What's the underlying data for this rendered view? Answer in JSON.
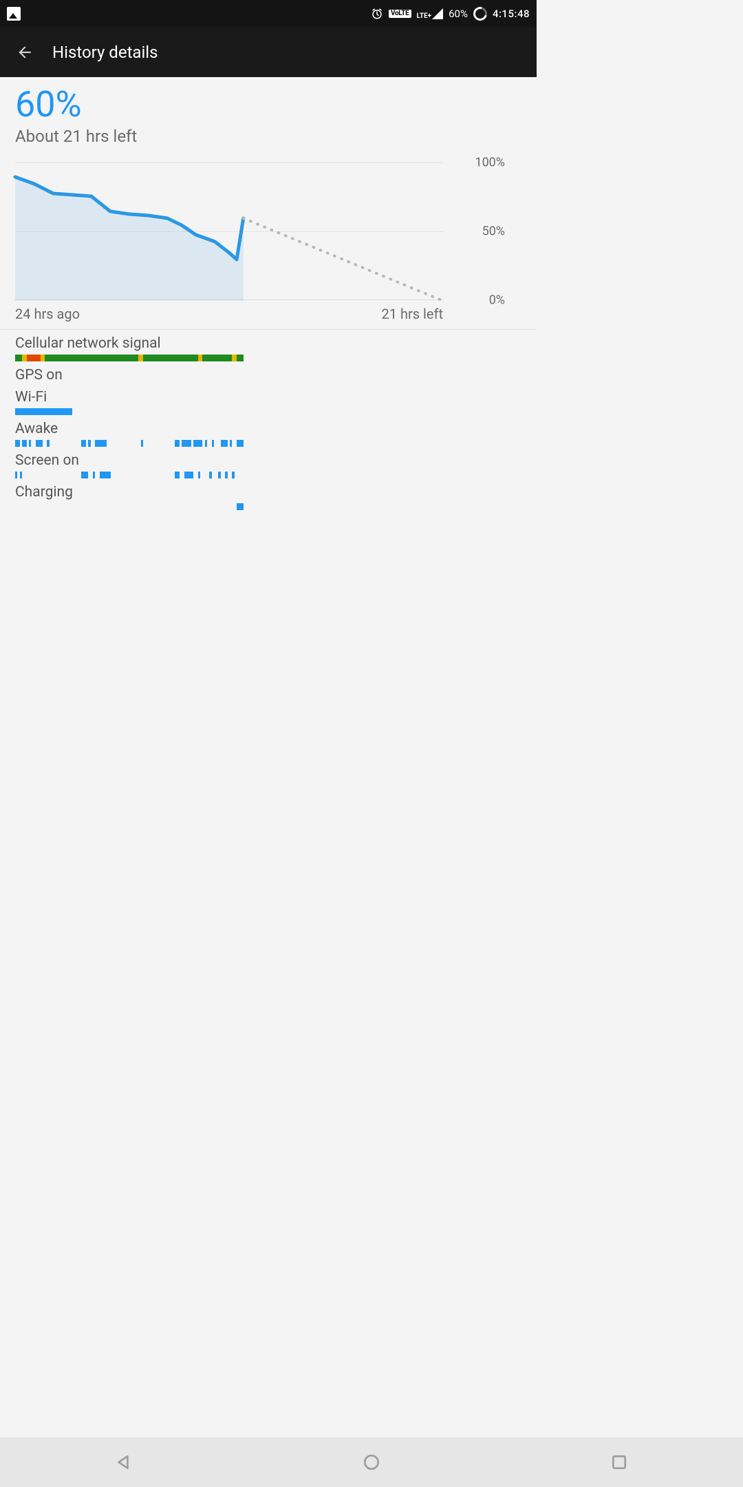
{
  "statusbar": {
    "volte": "VoLTE",
    "lte": "LTE+",
    "battery": "60%",
    "clock": "4:15:48"
  },
  "header": {
    "title": "History details"
  },
  "summary": {
    "percent": "60%",
    "estimate": "About 21 hrs left"
  },
  "chart_data": {
    "type": "line",
    "title": "",
    "xlabel": "",
    "ylabel": "",
    "x_range_hours": 45,
    "history_hours": 24,
    "ylim": [
      0,
      100
    ],
    "y_ticks": [
      "0%",
      "50%",
      "100%"
    ],
    "x_ticks": [
      "24 hrs ago",
      "21 hrs left"
    ],
    "series": [
      {
        "name": "history",
        "style": "solid-area",
        "color": "#2a98e3",
        "x": [
          0,
          2,
          4,
          6,
          8,
          10,
          12,
          14,
          16,
          17.5,
          19,
          21,
          22.5,
          23.3,
          24
        ],
        "values": [
          90,
          85,
          78,
          77,
          76,
          65,
          63,
          62,
          60,
          55,
          48,
          43,
          35,
          30,
          60
        ]
      },
      {
        "name": "projection",
        "style": "dotted",
        "color": "#b8b8b8",
        "x": [
          24,
          45
        ],
        "values": [
          60,
          0
        ]
      }
    ]
  },
  "timelines": {
    "width_pct": 53.3,
    "rows": [
      {
        "label": "Cellular network signal",
        "colorMode": "multi",
        "segments": [
          {
            "s": 0,
            "e": 3,
            "c": "#1f8a1f"
          },
          {
            "s": 3,
            "e": 5,
            "c": "#e9b500"
          },
          {
            "s": 5,
            "e": 11,
            "c": "#e04a00"
          },
          {
            "s": 11,
            "e": 13,
            "c": "#e9b500"
          },
          {
            "s": 13,
            "e": 80,
            "c": "#1f8a1f"
          },
          {
            "s": 54,
            "e": 56,
            "c": "#e9b500"
          },
          {
            "s": 80,
            "e": 82,
            "c": "#e9b500"
          },
          {
            "s": 82,
            "e": 100,
            "c": "#1f8a1f"
          },
          {
            "s": 95,
            "e": 97,
            "c": "#e9b500"
          }
        ]
      },
      {
        "label": "GPS on",
        "segments": []
      },
      {
        "label": "Wi-Fi",
        "segments": [
          {
            "s": 0,
            "e": 25
          }
        ]
      },
      {
        "label": "Awake",
        "segments": [
          {
            "s": 0,
            "e": 2
          },
          {
            "s": 3,
            "e": 5
          },
          {
            "s": 6,
            "e": 7
          },
          {
            "s": 9,
            "e": 12
          },
          {
            "s": 14,
            "e": 15
          },
          {
            "s": 29,
            "e": 31
          },
          {
            "s": 32,
            "e": 33
          },
          {
            "s": 35,
            "e": 40
          },
          {
            "s": 55,
            "e": 56
          },
          {
            "s": 70,
            "e": 72
          },
          {
            "s": 73,
            "e": 77
          },
          {
            "s": 78,
            "e": 82
          },
          {
            "s": 83,
            "e": 84
          },
          {
            "s": 86,
            "e": 87
          },
          {
            "s": 90,
            "e": 93
          },
          {
            "s": 94,
            "e": 95
          },
          {
            "s": 97,
            "e": 100
          }
        ]
      },
      {
        "label": "Screen on",
        "segments": [
          {
            "s": 0,
            "e": 1
          },
          {
            "s": 2,
            "e": 3
          },
          {
            "s": 29,
            "e": 32
          },
          {
            "s": 34,
            "e": 35
          },
          {
            "s": 37,
            "e": 42
          },
          {
            "s": 70,
            "e": 72
          },
          {
            "s": 74,
            "e": 78
          },
          {
            "s": 80,
            "e": 81
          },
          {
            "s": 85,
            "e": 86
          },
          {
            "s": 89,
            "e": 90
          },
          {
            "s": 92,
            "e": 93
          },
          {
            "s": 95,
            "e": 96
          }
        ]
      },
      {
        "label": "Charging",
        "segments": [
          {
            "s": 97,
            "e": 100
          }
        ]
      }
    ]
  }
}
